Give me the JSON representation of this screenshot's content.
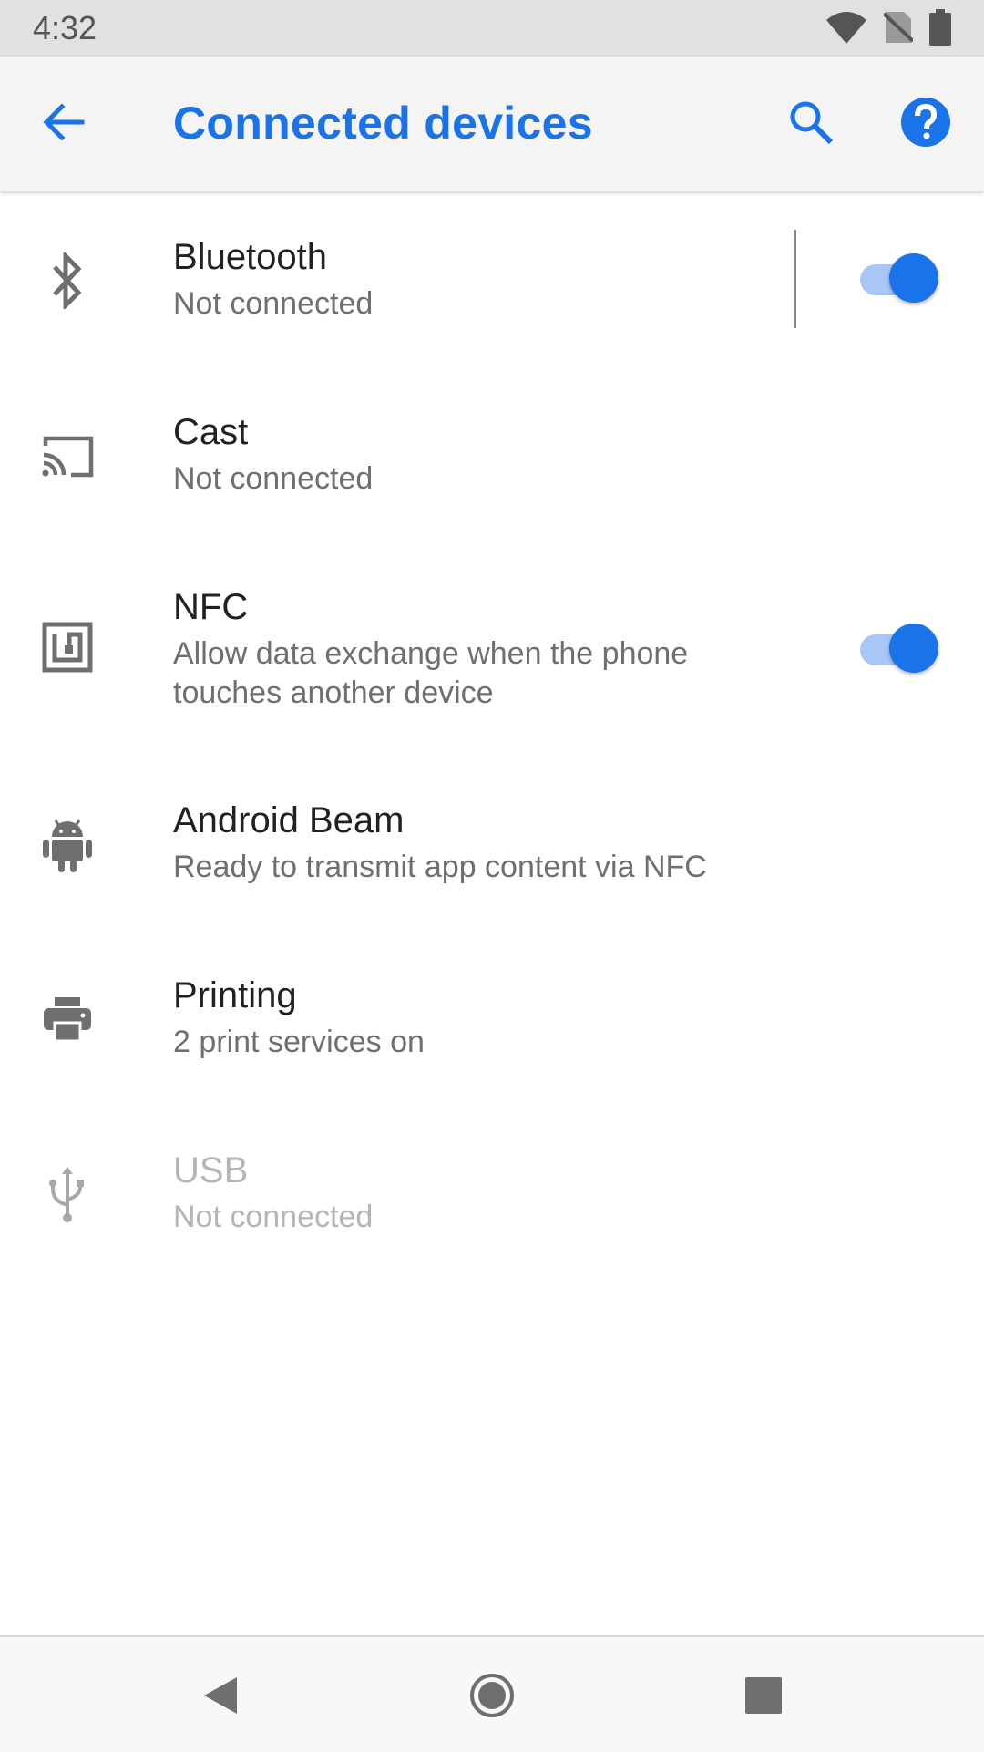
{
  "status_bar": {
    "time": "4:32",
    "icons": [
      "wifi-icon",
      "no-sim-icon",
      "battery-icon"
    ]
  },
  "app_bar": {
    "title": "Connected devices",
    "back_icon": "arrow-back-icon",
    "search_icon": "search-icon",
    "help_icon": "help-icon"
  },
  "colors": {
    "accent": "#1a73e8",
    "toggle_track": "#a9c7f6",
    "primary_text": "#202124",
    "secondary_text": "#6f6f6f",
    "disabled_text": "#b5b5b5",
    "icon_gray": "#6f6f6f"
  },
  "items": [
    {
      "title": "Bluetooth",
      "subtitle": "Not connected",
      "icon": "bluetooth-icon",
      "toggle": true,
      "enabled": true
    },
    {
      "title": "Cast",
      "subtitle": "Not connected",
      "icon": "cast-icon",
      "enabled": true
    },
    {
      "title": "NFC",
      "subtitle": "Allow data exchange when the phone touches another device",
      "icon": "nfc-icon",
      "toggle": true,
      "enabled": true
    },
    {
      "title": "Android Beam",
      "subtitle": "Ready to transmit app content via NFC",
      "icon": "android-icon",
      "enabled": true
    },
    {
      "title": "Printing",
      "subtitle": "2 print services on",
      "icon": "print-icon",
      "enabled": true
    },
    {
      "title": "USB",
      "subtitle": "Not connected",
      "icon": "usb-icon",
      "enabled": false
    }
  ],
  "nav_bar": {
    "icons": [
      "nav-back-icon",
      "nav-home-icon",
      "nav-recents-icon"
    ]
  }
}
